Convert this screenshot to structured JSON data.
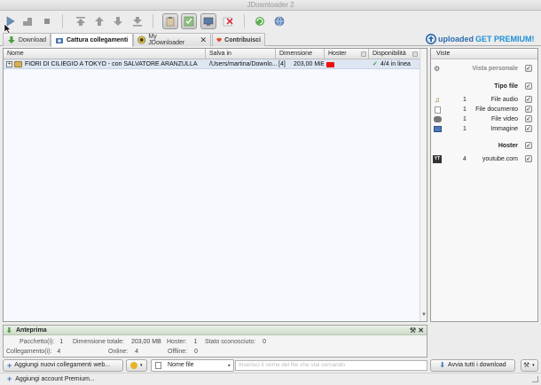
{
  "window": {
    "title": "JDownloader 2"
  },
  "tabs": [
    {
      "label": "Download"
    },
    {
      "label": "Cattura collegamenti"
    },
    {
      "label": "My JDownloader"
    },
    {
      "label": "Contribuisci"
    }
  ],
  "premium": {
    "brand": "uploaded",
    "text": "GET PREMIUM!"
  },
  "grid": {
    "columns": [
      "Nome",
      "Salva in",
      "Dimensione",
      "Hoster",
      "Disponibilità"
    ],
    "rows": [
      {
        "expand": "+",
        "name": "FIORI DI CILIEGIO A TOKYO - con SALVATORE ARANZULLA",
        "save_in": "/Users/martina/Downlo...",
        "count": "[4]",
        "size": "203,00 MiB",
        "hoster": "youtube",
        "availability": "4/4 in linea"
      }
    ]
  },
  "sidebar": {
    "header": "Viste",
    "personal_view": "Vista personale",
    "file_type_title": "Tipo file",
    "file_types": [
      {
        "count": "1",
        "label": "File audio"
      },
      {
        "count": "1",
        "label": "File documento"
      },
      {
        "count": "1",
        "label": "File video"
      },
      {
        "count": "1",
        "label": "Immagine"
      }
    ],
    "hoster_title": "Hoster",
    "hosters": [
      {
        "count": "4",
        "label": "youtube.com",
        "icon": "YT"
      }
    ]
  },
  "preview": {
    "title": "Anteprima",
    "packages_label": "Pacchetto(i):",
    "packages_value": "1",
    "total_size_label": "Dimensione totale:",
    "total_size_value": "203,00 MB",
    "hoster_label": "Hoster:",
    "hoster_value": "1",
    "unknown_label": "Stato sconosciuto:",
    "unknown_value": "0",
    "links_label": "Collegamento(i):",
    "links_value": "4",
    "online_label": "Online:",
    "online_value": "4",
    "offline_label": "Offline:",
    "offline_value": "0"
  },
  "bottom": {
    "add_links": "Aggiungi nuovi collegamenti web...",
    "filename_select": "Nome file",
    "search_placeholder": "Inserisci il nome del file che stai cercando",
    "start_all": "Avvia tutti i download"
  },
  "status": {
    "add_premium": "Aggiungi account Premium..."
  }
}
